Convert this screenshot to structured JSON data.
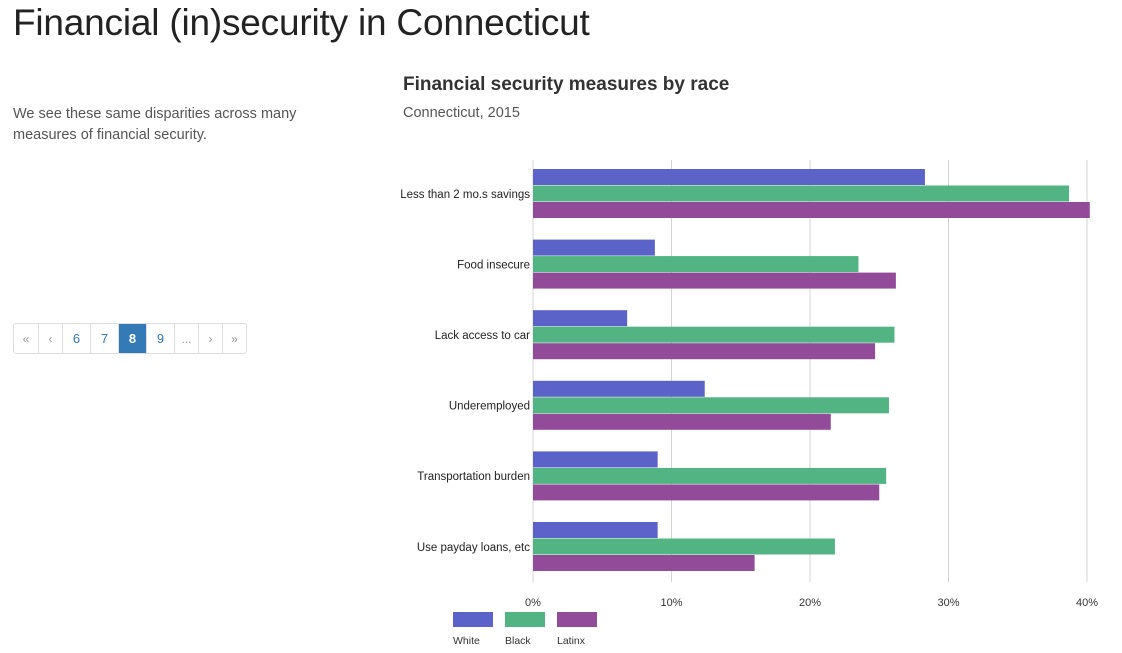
{
  "page": {
    "title": "Financial (in)security in Connecticut",
    "intro": "We see these same disparities across many measures of financial security."
  },
  "pagination": {
    "items": [
      {
        "label": "«",
        "name": "first-page-button",
        "state": "muted"
      },
      {
        "label": "‹",
        "name": "prev-page-button",
        "state": "muted"
      },
      {
        "label": "6",
        "name": "page-6-button",
        "state": "num"
      },
      {
        "label": "7",
        "name": "page-7-button",
        "state": "num"
      },
      {
        "label": "8",
        "name": "page-8-button",
        "state": "active"
      },
      {
        "label": "9",
        "name": "page-9-button",
        "state": "num"
      },
      {
        "label": "...",
        "name": "ellipsis-button",
        "state": "muted"
      },
      {
        "label": "›",
        "name": "next-page-button",
        "state": "muted"
      },
      {
        "label": "»",
        "name": "last-page-button",
        "state": "muted"
      }
    ]
  },
  "chart_data": {
    "type": "bar",
    "orientation": "horizontal",
    "title": "Financial security measures by race",
    "subtitle": "Connecticut, 2015",
    "xlabel": "",
    "ylabel": "",
    "xlim": [
      0,
      40
    ],
    "x_ticks": [
      0,
      10,
      20,
      30,
      40
    ],
    "x_tick_labels": [
      "0%",
      "10%",
      "20%",
      "30%",
      "40%"
    ],
    "grid": true,
    "legend_position": "bottom-left",
    "categories": [
      "Less than 2 mo.s savings",
      "Food insecure",
      "Lack access to car",
      "Underemployed",
      "Transportation burden",
      "Use payday loans, etc"
    ],
    "series": [
      {
        "name": "White",
        "color": "#5b63c9",
        "values": [
          28.3,
          8.8,
          6.8,
          12.4,
          9.0,
          9.0
        ]
      },
      {
        "name": "Black",
        "color": "#52b482",
        "values": [
          38.7,
          23.5,
          26.1,
          25.7,
          25.5,
          21.8
        ]
      },
      {
        "name": "Latinx",
        "color": "#924b99",
        "values": [
          40.2,
          26.2,
          24.7,
          21.5,
          25.0,
          16.0
        ]
      }
    ]
  }
}
